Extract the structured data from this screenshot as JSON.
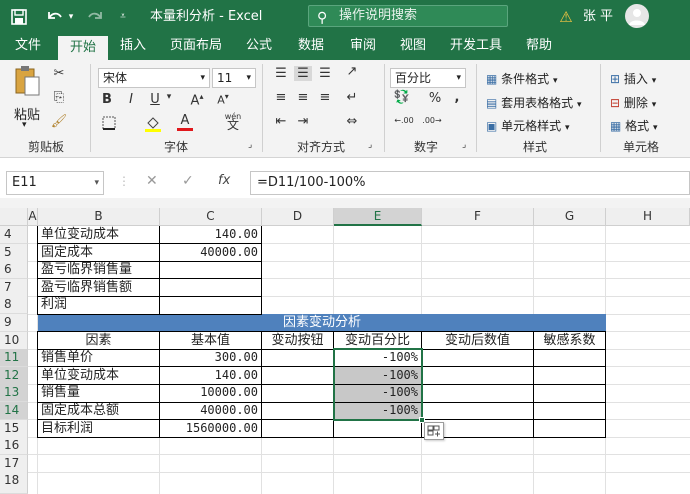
{
  "titlebar": {
    "save_icon": "save-icon",
    "undo_icon": "undo-icon",
    "redo_icon": "redo-icon",
    "title": "本量利分析 - Excel",
    "search": "操作说明搜索",
    "user": "张 平",
    "warning_icon": "warning-icon"
  },
  "tabs": [
    "文件",
    "开始",
    "插入",
    "页面布局",
    "公式",
    "数据",
    "审阅",
    "视图",
    "开发工具",
    "帮助"
  ],
  "ribbon": {
    "paste": "粘贴",
    "clipboard": "剪贴板",
    "font_name": "宋体",
    "font_size": "11",
    "font": "字体",
    "align": "对齐方式",
    "number_format": "百分比",
    "number": "数字",
    "cond_format": "条件格式",
    "table_format": "套用表格格式",
    "cell_style": "单元格样式",
    "styles": "样式",
    "insert": "插入",
    "delete": "删除",
    "format": "格式",
    "cells": "单元格",
    "bold": "B",
    "italic": "I",
    "underline": "U",
    "phonetic": "wén"
  },
  "formula": {
    "cell_ref": "E11",
    "fx": "fx",
    "content": "=D11/100-100%"
  },
  "columns": [
    "A",
    "B",
    "C",
    "D",
    "E",
    "F",
    "G",
    "H"
  ],
  "rows": [
    "4",
    "5",
    "6",
    "7",
    "8",
    "9",
    "10",
    "11",
    "12",
    "13",
    "14",
    "15",
    "16",
    "17",
    "18"
  ],
  "cells": {
    "b4": "单位变动成本",
    "c4": "140.00",
    "b5": "固定成本",
    "c5": "40000.00",
    "b6": "盈亏临界销售量",
    "b7": "盈亏临界销售额",
    "b8": "利润",
    "title9": "因素变动分析",
    "h_b10": "因素",
    "h_c10": "基本值",
    "h_d10": "变动按钮",
    "h_e10": "变动百分比",
    "h_f10": "变动后数值",
    "h_g10": "敏感系数",
    "b11": "销售单价",
    "c11": "300.00",
    "e11": "-100%",
    "b12": "单位变动成本",
    "c12": "140.00",
    "e12": "-100%",
    "b13": "销售量",
    "c13": "10000.00",
    "e13": "-100%",
    "b14": "固定成本总额",
    "c14": "40000.00",
    "e14": "-100%",
    "b15": "目标利润",
    "c15": "1560000.00"
  },
  "colors": {
    "excel_green": "#217346",
    "header_blue": "#4f81bd",
    "selection_gray": "#c8c8c8"
  }
}
